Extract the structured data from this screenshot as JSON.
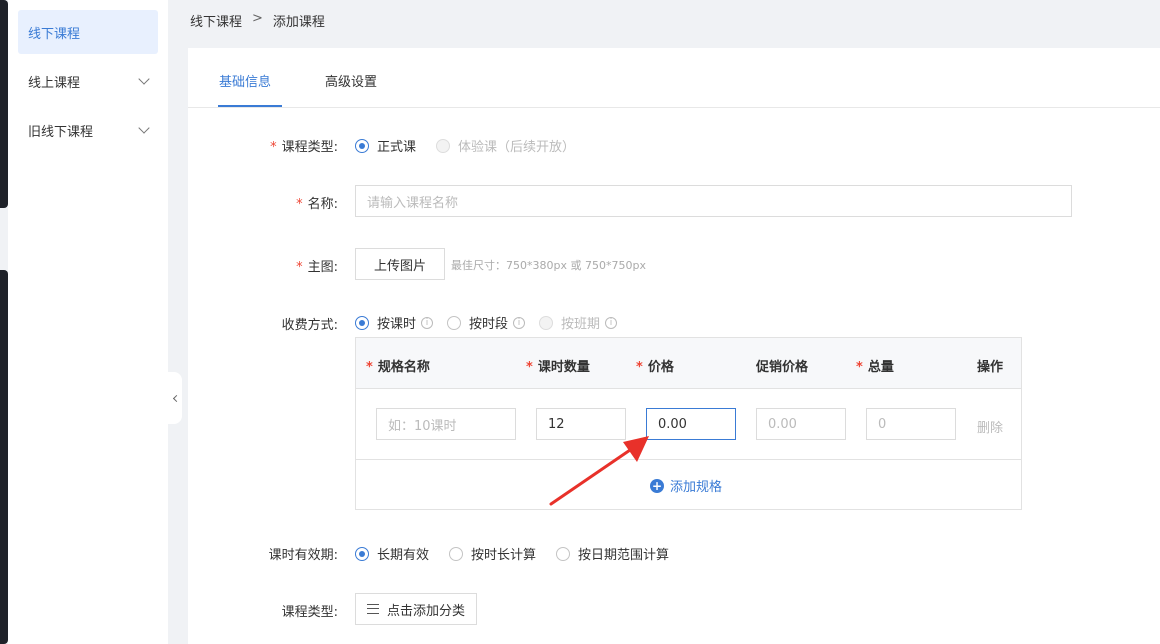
{
  "sidebar": {
    "items": [
      {
        "label": "线下课程",
        "active": true
      },
      {
        "label": "线上课程"
      },
      {
        "label": "旧线下课程"
      }
    ]
  },
  "breadcrumb": {
    "parent": "线下课程",
    "separator": ">",
    "current": "添加课程"
  },
  "tabs": [
    {
      "label": "基础信息"
    },
    {
      "label": "高级设置"
    }
  ],
  "form": {
    "course_type": {
      "label": "课程类型:",
      "options": [
        "正式课",
        "体验课（后续开放）"
      ]
    },
    "name": {
      "label": "名称:",
      "placeholder": "请输入课程名称"
    },
    "main_image": {
      "label": "主图:",
      "button": "上传图片",
      "hint": "最佳尺寸：750*380px 或 750*750px"
    },
    "charge": {
      "label": "收费方式:",
      "options": [
        "按课时",
        "按时段",
        "按班期"
      ]
    },
    "spec_table": {
      "headers": [
        "规格名称",
        "课时数量",
        "价格",
        "促销价格",
        "总量",
        "操作"
      ],
      "row": {
        "name_placeholder": "如：10课时",
        "hours": "12",
        "price": "0.00",
        "promo_placeholder": "0.00",
        "total_placeholder": "0",
        "delete": "删除"
      },
      "add_label": "添加规格"
    },
    "validity": {
      "label": "课时有效期:",
      "options": [
        "长期有效",
        "按时长计算",
        "按日期范围计算"
      ]
    },
    "category": {
      "label": "课程类型:",
      "button": "点击添加分类"
    }
  },
  "colors": {
    "accent": "#3a7bd5",
    "required": "#e43",
    "arrow": "#e8312a"
  }
}
